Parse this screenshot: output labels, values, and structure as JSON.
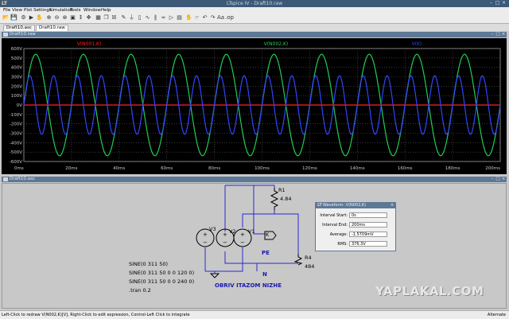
{
  "window": {
    "title": "LTspice IV - Draft10.raw"
  },
  "menu": [
    "File",
    "View",
    "Plot Settings",
    "Simulation",
    "Tools",
    "Window",
    "Help"
  ],
  "toolbar_icons": [
    "open-icon",
    "save-icon",
    "settings-icon",
    "run-icon",
    "halt-icon",
    "zoom-in-icon",
    "zoom-out-icon",
    "zoom-area-icon",
    "zoom-fit-icon",
    "autorange-icon",
    "pan-icon",
    "tile-icon",
    "cascade-icon",
    "close-window-icon",
    "wire-icon",
    "ground-icon",
    "label-icon",
    "resistor-icon",
    "capacitor-icon",
    "inductor-icon",
    "diode-icon",
    "component-icon",
    "move-icon",
    "drag-icon",
    "undo-icon",
    "redo-icon",
    "text-icon",
    "spice-directive-icon"
  ],
  "tabs": [
    "Draft10.asc",
    "Draft10.raw"
  ],
  "plot_window": {
    "title": "Draft10.raw"
  },
  "schematic_window": {
    "title": "Draft10.asc"
  },
  "chart_data": {
    "type": "line",
    "xlabel": "",
    "ylabel": "",
    "xlim": [
      0,
      200
    ],
    "ylim": [
      -600,
      600
    ],
    "x_ticks": [
      "0ms",
      "20ms",
      "40ms",
      "60ms",
      "80ms",
      "100ms",
      "120ms",
      "140ms",
      "160ms",
      "180ms",
      "200ms"
    ],
    "y_ticks": [
      "600V",
      "500V",
      "400V",
      "300V",
      "200V",
      "100V",
      "0V",
      "-100V",
      "-200V",
      "-300V",
      "-400V",
      "-500V",
      "-600V"
    ],
    "y_tick_values": [
      600,
      500,
      400,
      300,
      200,
      100,
      0,
      -100,
      -200,
      -300,
      -400,
      -500,
      -600
    ],
    "grid": true,
    "series": [
      {
        "name": "V(N001,K)",
        "color": "#ff2020",
        "amplitude": 0,
        "freq_hz": 50,
        "phase_deg": 0
      },
      {
        "name": "V(N002,K)",
        "color": "#22cc55",
        "amplitude": 539,
        "freq_hz": 50,
        "phase_deg": 0
      },
      {
        "name": "V(K)",
        "color": "#3344ff",
        "amplitude": 311,
        "freq_hz": 100,
        "phase_deg": 0
      }
    ]
  },
  "schematic": {
    "components": [
      {
        "ref": "R1",
        "value": "4.84"
      },
      {
        "ref": "R4",
        "value": "484"
      },
      {
        "ref": "V3"
      },
      {
        "ref": "V2"
      },
      {
        "ref": "V1"
      }
    ],
    "net_labels": [
      "K",
      "PE",
      "N"
    ],
    "source_specs": [
      "SINE(0 311 50)",
      "SINE(0 311 50 0 0 120 0)",
      "SINE(0 311 50 0 0 240 0)"
    ],
    "directive": ".tran 0.2",
    "comment": "OBRIV ITAZOM NIZHE"
  },
  "waveform_dialog": {
    "title": "Waveform: V(N002,K)",
    "fields": [
      {
        "label": "Interval Start:",
        "value": "0s"
      },
      {
        "label": "Interval End:",
        "value": "200ms"
      },
      {
        "label": "Average:",
        "value": "-1.5709mV"
      },
      {
        "label": "RMS:",
        "value": "376.3V"
      }
    ]
  },
  "watermark": "YAPLAKAL.COM",
  "statusbar": {
    "text": "Left-Click to redraw V(N002,K)[V], Right-Click to edit expression, Control-Left Click to integrate",
    "mode": "Alternate"
  }
}
